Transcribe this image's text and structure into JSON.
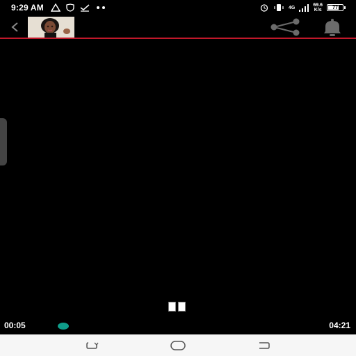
{
  "status_bar": {
    "time": "9:29 AM",
    "network_type": "4G",
    "speed_value": "69.6",
    "speed_unit": "K/s",
    "battery_level": "77",
    "battery_fraction": 0.77,
    "icons": [
      "warning-icon",
      "shield-icon",
      "check-icon",
      "more-dots-icon",
      "alarm-icon",
      "vibrate-icon",
      "signal-icon",
      "battery-icon"
    ]
  },
  "toolbar": {
    "back_icon": "back-chevron-icon",
    "share_icon": "share-icon",
    "bell_icon": "bell-icon",
    "accent_color": "#c0182a"
  },
  "player": {
    "current_time": "00:05",
    "total_time": "04:21",
    "progress_fraction": 0.019,
    "state": "playing",
    "seek_color": "#0f9d8a"
  },
  "nav_bar": {
    "icons": [
      "recent-apps-icon",
      "home-icon",
      "back-nav-icon"
    ]
  }
}
